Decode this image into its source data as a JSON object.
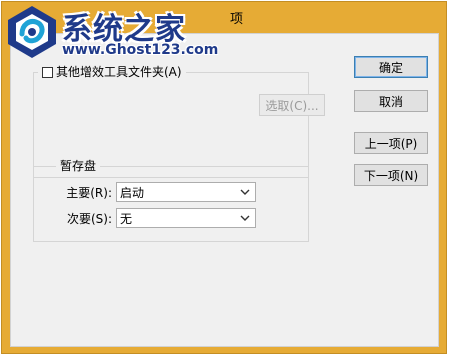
{
  "titlebar": {
    "title_fragment": "项"
  },
  "watermark": {
    "site_name": "系统之家",
    "url": "www.Ghost123.com"
  },
  "group_plugins": {
    "checkbox_label": "其他增效工具文件夹(A)",
    "checked": false,
    "choose_button": "选取(C)..."
  },
  "group_scratch": {
    "legend": "暂存盘",
    "primary_label": "主要(R):",
    "primary_value": "启动",
    "secondary_label": "次要(S):",
    "secondary_value": "无"
  },
  "buttons": {
    "ok": "确定",
    "cancel": "取消",
    "prev": "上一项(P)",
    "next": "下一项(N)"
  },
  "colors": {
    "window_frame": "#e6ab35",
    "client_bg": "#f0f0f0",
    "logo_blue": "#1f3a8a"
  }
}
